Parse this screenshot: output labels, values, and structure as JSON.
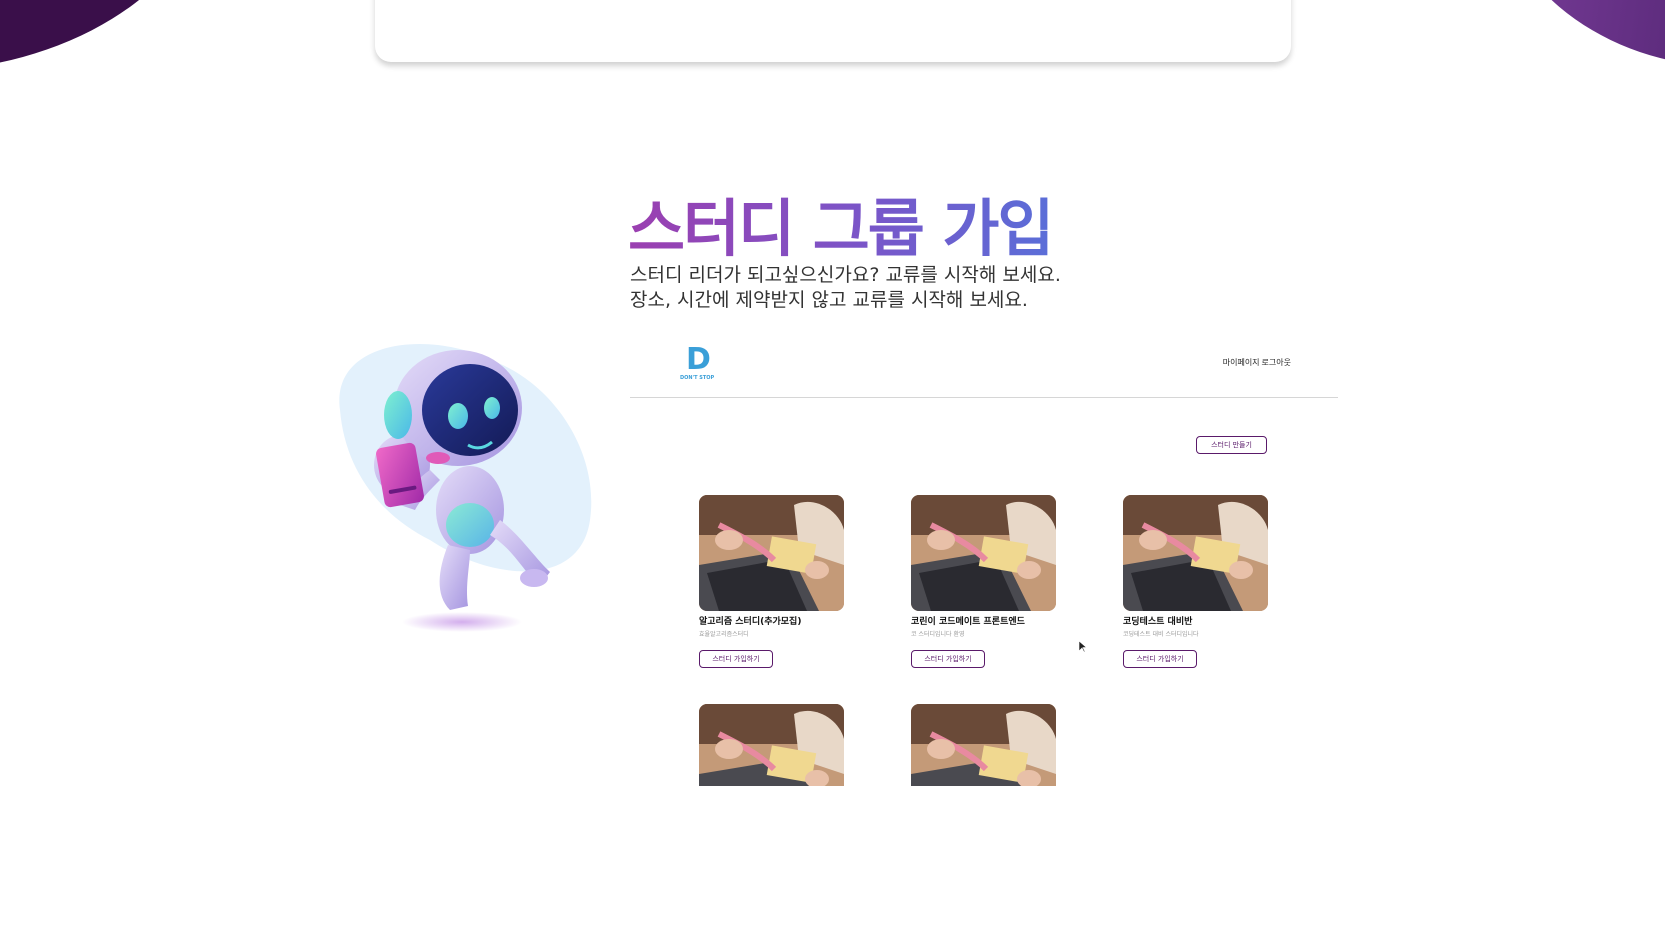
{
  "hero": {
    "title": "스터디 그룹 가입",
    "subtitle_line1": "스터디 리더가 되고싶으신가요? 교류를 시작해 보세요.",
    "subtitle_line2": "장소, 시간에 제약받지 않고 교류를 시작해 보세요."
  },
  "nav": {
    "logo_letter": "D",
    "logo_text": "DON'T STOP",
    "mypage": "마이페이지",
    "logout": "로그아웃"
  },
  "actions": {
    "create_study": "스터디 만들기"
  },
  "studies": [
    {
      "name": "알고리즘 스터디(추가모집)",
      "desc": "효율알고리즘스터디",
      "join": "스터디 가입하기"
    },
    {
      "name": "코린이 코드메이트 프론트엔드",
      "desc": "코 스터디입니다 환영",
      "join": "스터디 가입하기"
    },
    {
      "name": "코딩테스트 대비반",
      "desc": "코딩테스트 대비 스터디입니다",
      "join": "스터디 가입하기"
    },
    {
      "name": "",
      "desc": "",
      "join": ""
    },
    {
      "name": "",
      "desc": "",
      "join": ""
    }
  ],
  "colors": {
    "accent": "#5a1a6a",
    "title_gradient_start": "#9b3fb0",
    "title_gradient_end": "#5a6ed8",
    "logo": "#3a9fd8"
  },
  "icons": {
    "robot": "robot-illustration",
    "cursor": "mouse-pointer-icon"
  }
}
